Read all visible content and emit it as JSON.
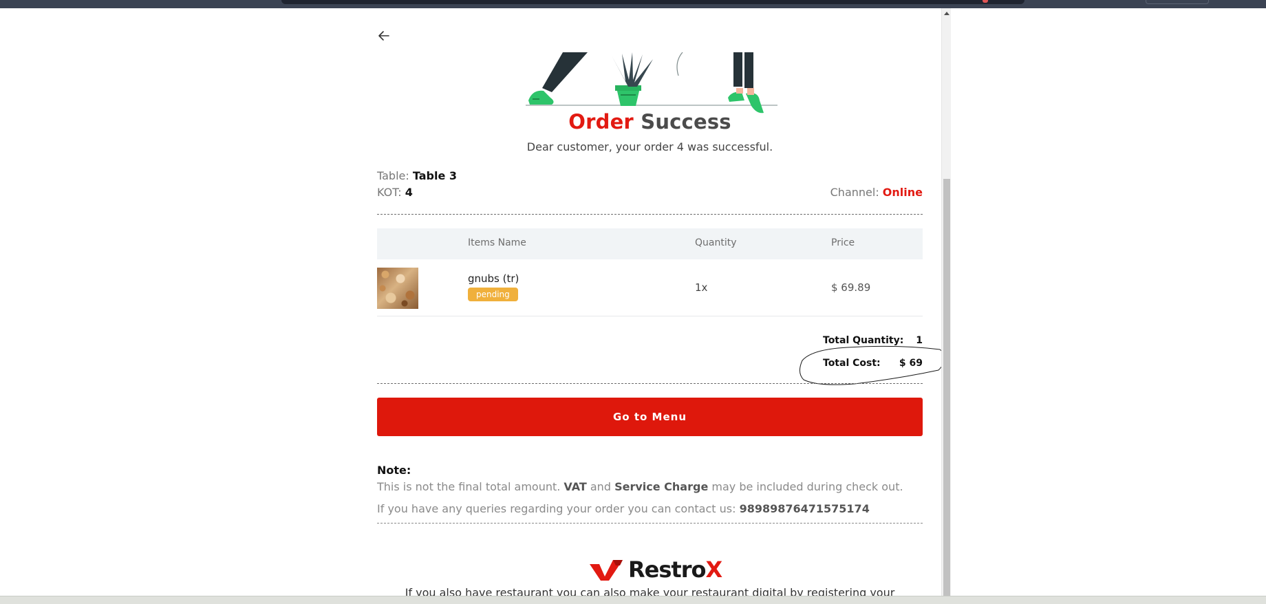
{
  "header": {
    "title_part1": "Order",
    "title_part2": "Success",
    "subtitle": "Dear customer, your order 4 was successful."
  },
  "order": {
    "table_label": "Table:",
    "table_value": "Table 3",
    "kot_label": "KOT:",
    "kot_value": "4",
    "channel_label": "Channel:",
    "channel_value": "Online"
  },
  "items_table": {
    "columns": [
      "Items Name",
      "Quantity",
      "Price"
    ],
    "rows": [
      {
        "name": "gnubs (tr)",
        "status": "pending",
        "quantity": "1x",
        "price": "$ 69.89"
      }
    ]
  },
  "totals": {
    "quantity_label": "Total Quantity:",
    "quantity_value": "1",
    "cost_label": "Total Cost:",
    "cost_value": "$ 69"
  },
  "actions": {
    "menu_button": "Go to Menu"
  },
  "note": {
    "title": "Note:",
    "line1_a": "This is not the final total amount.",
    "line1_vat": "VAT",
    "line1_and": "and",
    "line1_service": "Service Charge",
    "line1_b": "may be included during check out.",
    "line2_a": "If you have any queries regarding your order you can contact us:",
    "line2_phone": "98989876471575174"
  },
  "footer": {
    "brand": "Restro",
    "brand_x": "X",
    "text": "If you also have restaurant you can also make your restaurant digital by registering your"
  },
  "colors": {
    "accent": "#e21a12",
    "badge": "#f0b03c",
    "button": "#de180c",
    "table_header": "#f1f4f6"
  },
  "icons": {
    "back": "arrow-left-icon",
    "brand": "restrox-logo-icon"
  }
}
